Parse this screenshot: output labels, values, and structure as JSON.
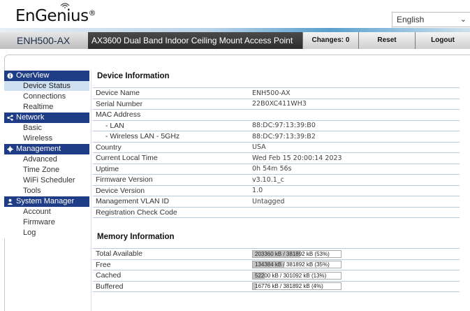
{
  "brand": {
    "logo_text": "EnGenius",
    "registered_mark": "®"
  },
  "language": {
    "selected": "English"
  },
  "navbar": {
    "model": "ENH500-AX",
    "product": "AX3600 Dual Band Indoor Ceiling Mount Access Point",
    "changes_label": "Changes: 0",
    "reset_label": "Reset",
    "logout_label": "Logout"
  },
  "sidebar": {
    "sections": [
      {
        "title": "OverView",
        "icon": "info-icon",
        "items": [
          "Device Status",
          "Connections",
          "Realtime"
        ]
      },
      {
        "title": "Network",
        "icon": "share-icon",
        "items": [
          "Basic",
          "Wireless"
        ]
      },
      {
        "title": "Management",
        "icon": "gear-icon",
        "items": [
          "Advanced",
          "Time Zone",
          "WiFi Scheduler",
          "Tools"
        ]
      },
      {
        "title": "System Manager",
        "icon": "user-icon",
        "items": [
          "Account",
          "Firmware",
          "Log"
        ]
      }
    ],
    "active_item": "Device Status"
  },
  "device_info": {
    "title": "Device Information",
    "rows": [
      {
        "label": "Device Name",
        "value": "ENH500-AX"
      },
      {
        "label": "Serial Number",
        "value": "22B0XC411WH3"
      },
      {
        "label": "MAC Address",
        "value": ""
      },
      {
        "label": "- LAN",
        "value": "88:DC:97:13:39:B0",
        "sub": true
      },
      {
        "label": "- Wireless LAN - 5GHz",
        "value": "88:DC:97:13:39:B2",
        "sub": true
      },
      {
        "label": "Country",
        "value": "USA"
      },
      {
        "label": "Current Local Time",
        "value": "Wed Feb 15 20:00:14 2023"
      },
      {
        "label": "Uptime",
        "value": "0h 54m 56s"
      },
      {
        "label": "Firmware Version",
        "value": "v3.10.1_c"
      },
      {
        "label": "Device Version",
        "value": "1.0"
      },
      {
        "label": "Management VLAN ID",
        "value": "Untagged"
      },
      {
        "label": "Registration Check Code",
        "value": ""
      }
    ]
  },
  "memory_info": {
    "title": "Memory Information",
    "rows": [
      {
        "label": "Total Available",
        "text": "203360 kB / 381892 kB (53%)",
        "percent": 53
      },
      {
        "label": "Free",
        "text": "134384 kB / 381892 kB (35%)",
        "percent": 35
      },
      {
        "label": "Cached",
        "text": "52200 kB / 301092 kB (13%)",
        "percent": 13
      },
      {
        "label": "Buffered",
        "text": "16776 kB / 381892 kB (4%)",
        "percent": 4
      }
    ]
  }
}
